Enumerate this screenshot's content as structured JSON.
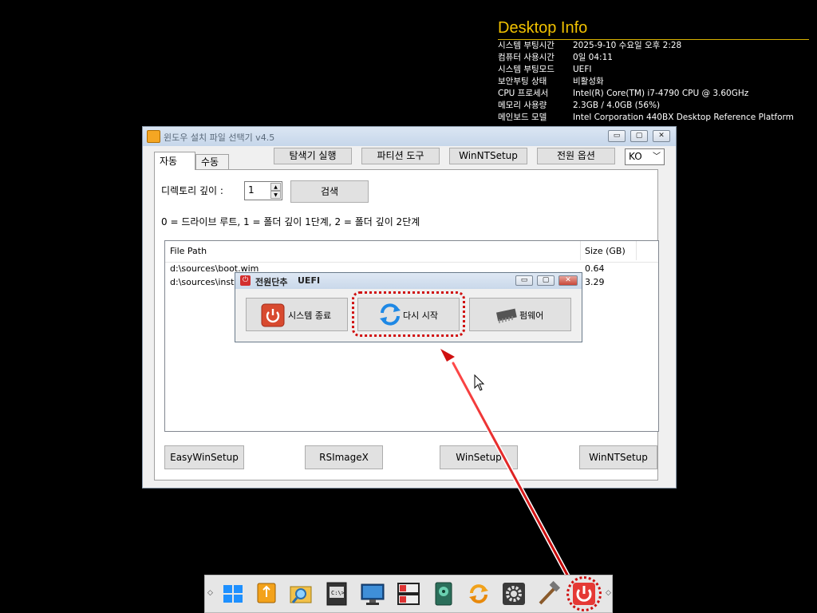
{
  "desktop_info": {
    "title": "Desktop Info",
    "rows": [
      {
        "label": "시스템 부팅시간",
        "value": "2025-9-10 수요일 오후 2:28"
      },
      {
        "label": "컴퓨터 사용시간",
        "value": "0일 04:11"
      },
      {
        "label": "시스템 부팅모드",
        "value": "UEFI"
      },
      {
        "label": "보안부팅 상태",
        "value": "비활성화"
      },
      {
        "label": "CPU 프로세서",
        "value": "Intel(R) Core(TM) i7-4790 CPU @ 3.60GHz"
      },
      {
        "label": "메모리 사용량",
        "value": "2.3GB / 4.0GB (56%)"
      },
      {
        "label": "메인보드 모델",
        "value": "Intel Corporation 440BX Desktop Reference Platform"
      }
    ]
  },
  "main_window": {
    "title": "윈도우 설치 파일 선택기 v4.5",
    "window_buttons": {
      "minimize": "▭",
      "restore": "▢",
      "close": "✕"
    },
    "tabs": [
      {
        "label": "자동"
      },
      {
        "label": "수동"
      }
    ],
    "toolbar": {
      "explorer": "탐색기 실행",
      "partition": "파티션 도구",
      "winntsetup": "WinNTSetup",
      "power": "전원 옵션",
      "language": "KO"
    },
    "depth_label": "디렉토리 깊이 :",
    "depth_value": "1",
    "search_button": "검색",
    "depth_hint": "0 = 드라이브 루트, 1 = 폴더 깊이 1단계, 2 = 폴더 깊이 2단계",
    "list": {
      "columns": [
        "File Path",
        "Size (GB)"
      ],
      "rows": [
        {
          "path": "d:\\sources\\boot.wim",
          "size": "0.64"
        },
        {
          "path": "d:\\sources\\install",
          "size": "3.29"
        }
      ]
    },
    "bottom_buttons": [
      "EasyWinSetup",
      "RSImageX",
      "WinSetup",
      "WinNTSetup"
    ]
  },
  "power_dialog": {
    "title": "전원단추",
    "mode": "UEFI",
    "buttons": {
      "shutdown": "시스템 종료",
      "restart": "다시 시작",
      "firmware": "펌웨어"
    }
  },
  "colors": {
    "highlight": "#d01010",
    "desktop_info_title": "#f2c200"
  },
  "taskbar": {
    "icons": [
      "windows-start-icon",
      "usb-drive-icon",
      "file-search-icon",
      "console-icon",
      "monitor-icon",
      "partition-icon",
      "disk-icon",
      "refresh-icon",
      "settings-icon",
      "tools-icon",
      "power-icon"
    ]
  }
}
